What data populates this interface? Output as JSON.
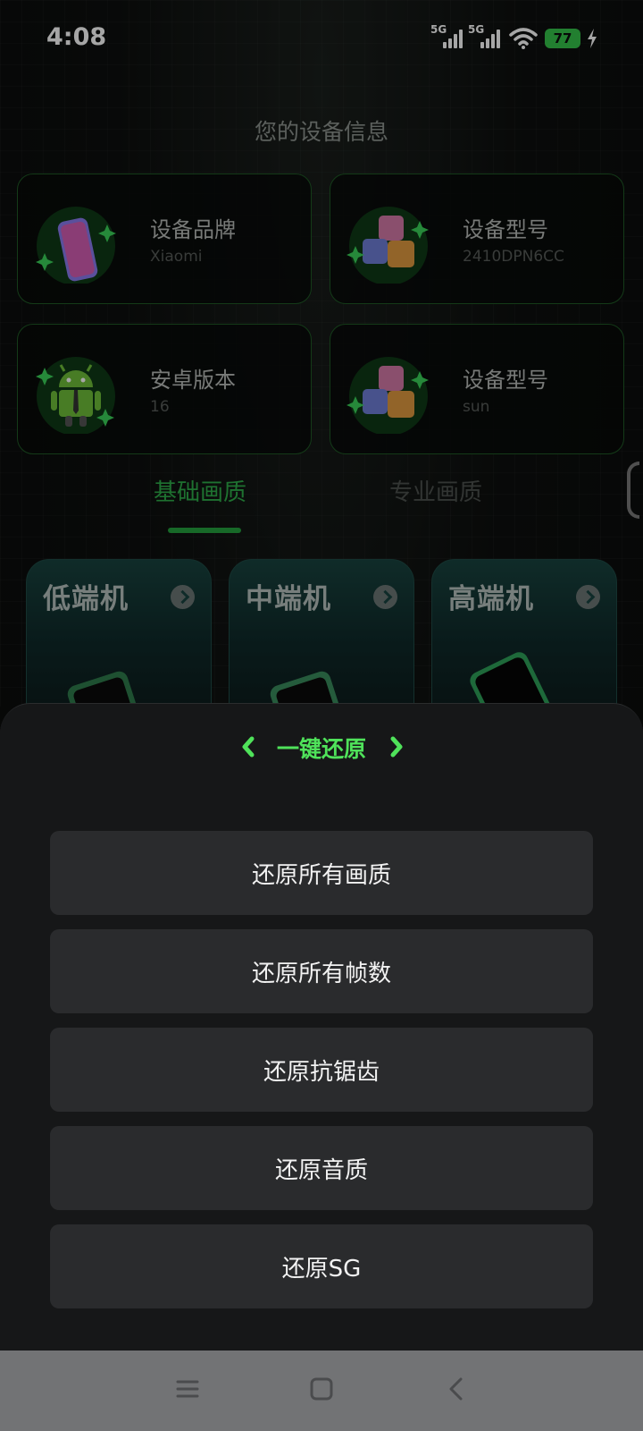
{
  "status_bar": {
    "time": "4:08",
    "signal1": "5G",
    "signal2": "5G",
    "battery": "77"
  },
  "page_title": "您的设备信息",
  "info_cards": [
    {
      "label": "设备品牌",
      "value": "Xiaomi",
      "icon": "phone-icon"
    },
    {
      "label": "设备型号",
      "value": "2410DPN6CC",
      "icon": "abc-blocks-icon"
    },
    {
      "label": "安卓版本",
      "value": "16",
      "icon": "android-robot-icon"
    },
    {
      "label": "设备型号",
      "value": "sun",
      "icon": "abc-blocks-icon"
    }
  ],
  "tabs": [
    {
      "label": "基础画质",
      "active": true
    },
    {
      "label": "专业画质",
      "active": false
    }
  ],
  "device_tiles": [
    {
      "label": "低端机"
    },
    {
      "label": "中端机"
    },
    {
      "label": "高端机"
    }
  ],
  "sheet": {
    "title": "一键还原",
    "buttons": [
      "还原所有画质",
      "还原所有帧数",
      "还原抗锯齿",
      "还原音质",
      "还原SG"
    ]
  },
  "colors": {
    "accent": "#2fae4a",
    "sheet_title": "#4fe25a",
    "card_border": "#1f5a26"
  }
}
